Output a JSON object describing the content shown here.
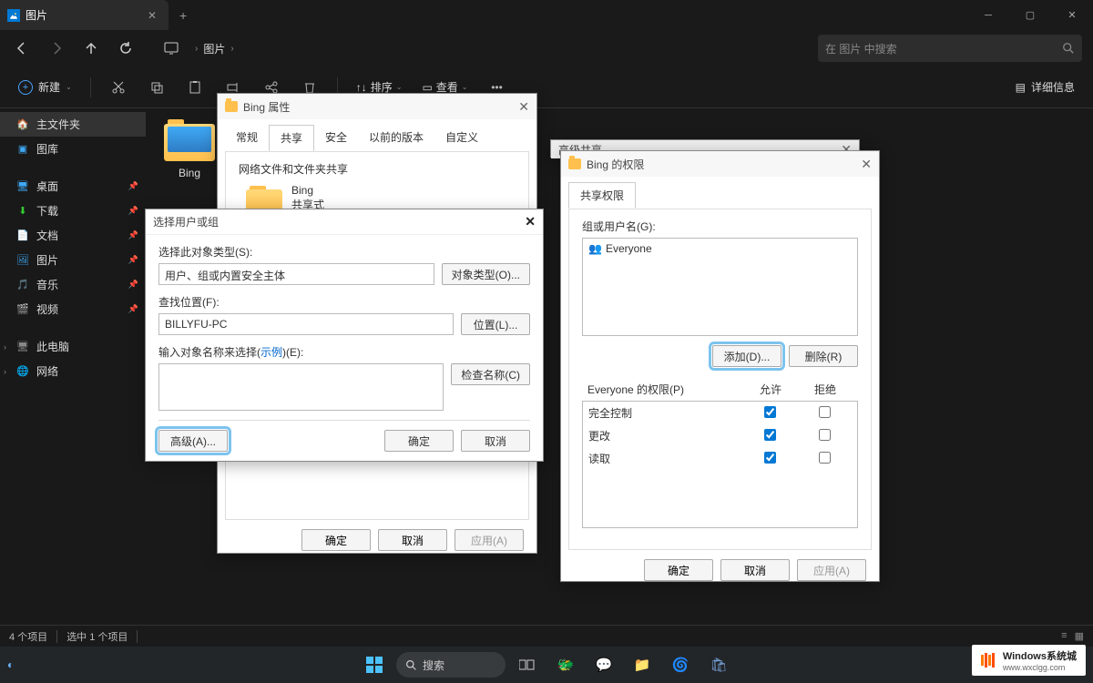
{
  "titlebar": {
    "tab_title": "图片",
    "new_tab": "+"
  },
  "nav": {
    "breadcrumb": [
      "图片"
    ],
    "search_placeholder": "在 图片 中搜索"
  },
  "toolbar": {
    "new_label": "新建",
    "sort_label": "排序",
    "view_label": "查看",
    "details_label": "详细信息"
  },
  "sidebar": {
    "home": "主文件夹",
    "gallery": "图库",
    "desktop": "桌面",
    "downloads": "下载",
    "documents": "文档",
    "pictures": "图片",
    "music": "音乐",
    "videos": "视频",
    "this_pc": "此电脑",
    "network": "网络"
  },
  "content": {
    "folder_name": "Bing"
  },
  "statusbar": {
    "count": "4 个项目",
    "selected": "选中 1 个项目"
  },
  "taskbar": {
    "search": "搜索"
  },
  "dlg_props": {
    "title": "Bing 属性",
    "tabs": {
      "general": "常规",
      "sharing": "共享",
      "security": "安全",
      "previous": "以前的版本",
      "custom": "自定义"
    },
    "section": "网络文件和文件夹共享",
    "item_name": "Bing",
    "item_state": "共享式",
    "ok": "确定",
    "cancel": "取消",
    "apply": "应用(A)"
  },
  "dlg_select": {
    "title": "选择用户或组",
    "object_type_label": "选择此对象类型(S):",
    "object_type_value": "用户、组或内置安全主体",
    "object_type_btn": "对象类型(O)...",
    "location_label": "查找位置(F):",
    "location_value": "BILLYFU-PC",
    "location_btn": "位置(L)...",
    "names_label_pre": "输入对象名称来选择(",
    "names_label_link": "示例",
    "names_label_post": ")(E):",
    "check_btn": "检查名称(C)",
    "advanced_btn": "高级(A)...",
    "ok": "确定",
    "cancel": "取消"
  },
  "dlg_adv_share": {
    "title": "高级共享"
  },
  "dlg_perms": {
    "title": "Bing 的权限",
    "tab": "共享权限",
    "group_label": "组或用户名(G):",
    "everyone": "Everyone",
    "add_btn": "添加(D)...",
    "remove_btn": "删除(R)",
    "perm_header": "Everyone 的权限(P)",
    "allow": "允许",
    "deny": "拒绝",
    "full": "完全控制",
    "change": "更改",
    "read": "读取",
    "ok": "确定",
    "cancel": "取消",
    "apply": "应用(A)"
  },
  "watermark": {
    "line1": "Windows系统城",
    "line2": "www.wxclgg.com"
  }
}
